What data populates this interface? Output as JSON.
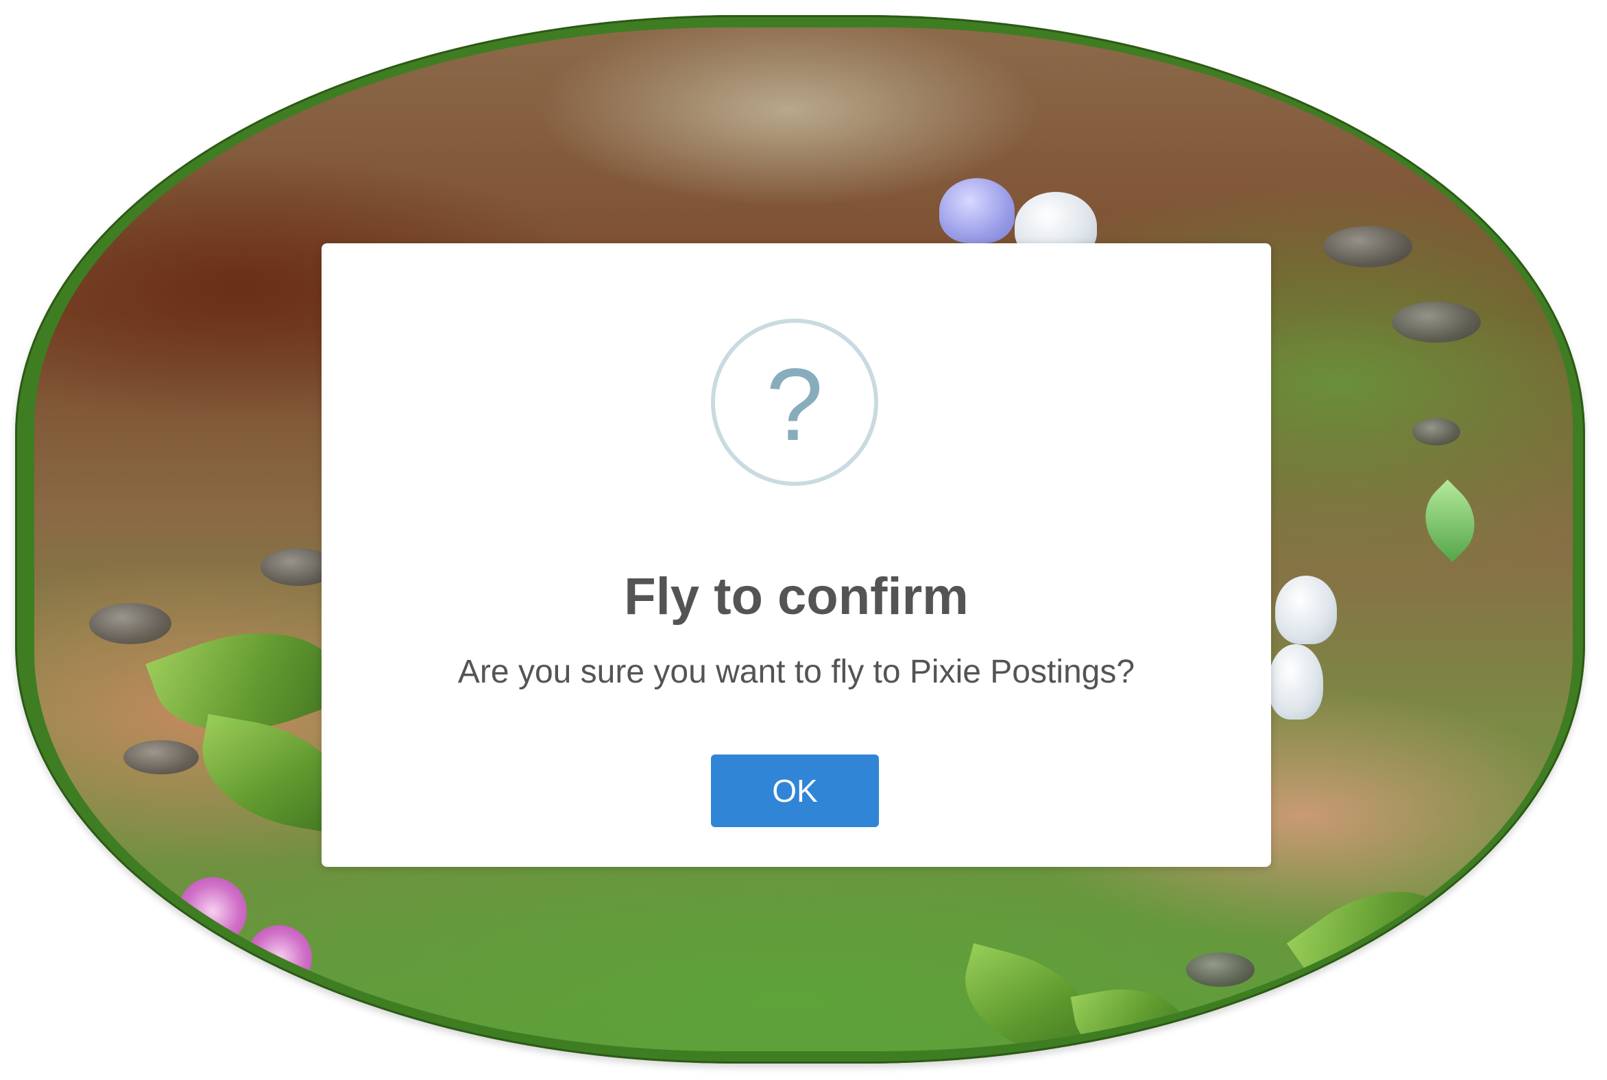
{
  "dialog": {
    "icon": "question-icon",
    "icon_glyph": "?",
    "title": "Fly to confirm",
    "message": "Are you sure you want to fly to Pixie Postings?",
    "confirm_label": "OK"
  },
  "colors": {
    "confirm_button": "#3085d6",
    "icon_ring": "#c9dae1",
    "icon_glyph": "#87adbd",
    "text": "#545454",
    "vine_border": "#3f7d22"
  }
}
